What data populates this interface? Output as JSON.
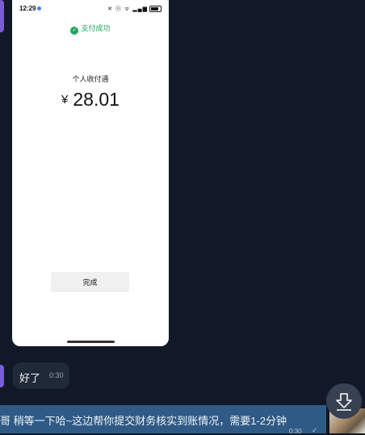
{
  "phone": {
    "status_time": "12:29",
    "status_icons": "✕ ⓝ ᯤ ▂▄▆",
    "payment_status": "支付成功",
    "merchant": "个人收付通",
    "currency": "¥",
    "amount": "28.01",
    "done_button": "完成"
  },
  "reply": {
    "text": "好了",
    "time": "0:30"
  },
  "incoming": {
    "text": "哥  稍等一下哈~这边帮你提交财务核实到账情况，需要1-2分钟",
    "time": "0:30",
    "check": "✓"
  },
  "colors": {
    "background": "#111827",
    "success_green": "#22a559",
    "bar_blue": "#2f5a85",
    "avatar_purple": "#7c5cd6"
  }
}
